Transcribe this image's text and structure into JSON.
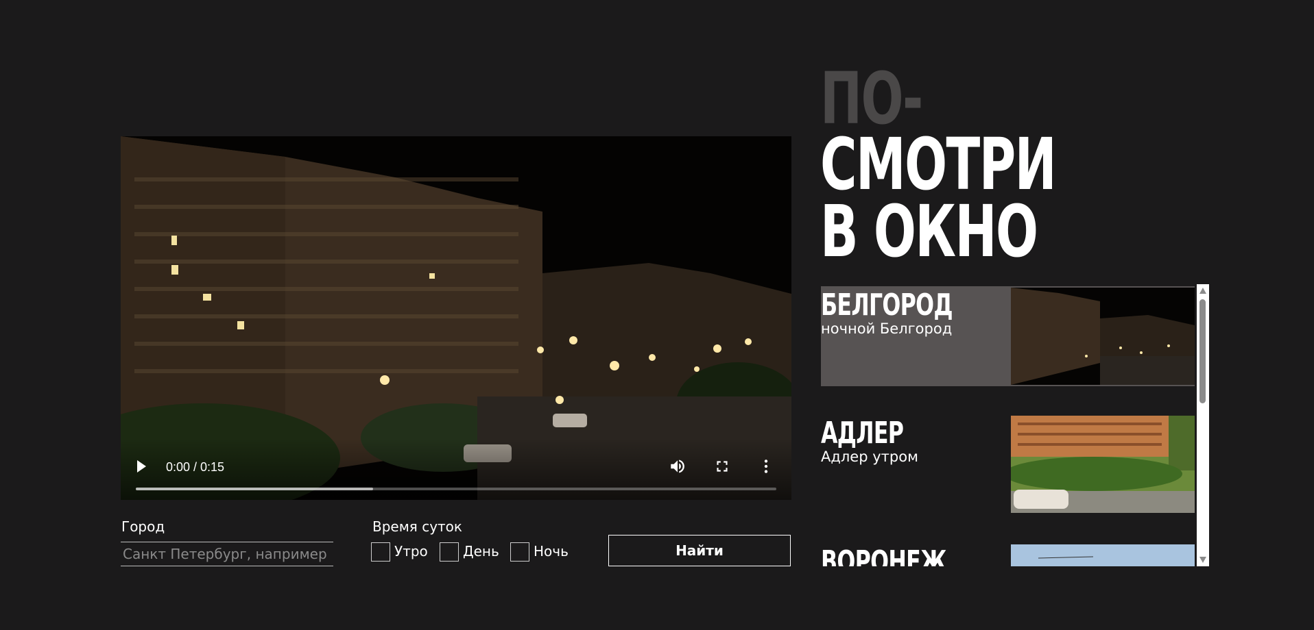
{
  "header": {
    "title_line1": "ПО-",
    "title_line2": "СМОТРИ",
    "title_line3": "В ОКНО"
  },
  "player": {
    "time": "0:00 / 0:15",
    "progress_fraction": 0.37
  },
  "search": {
    "city_label": "Город",
    "city_placeholder": "Санкт Петербург, например",
    "time_label": "Время суток",
    "options": [
      "Утро",
      "День",
      "Ночь"
    ],
    "find_label": "Найти"
  },
  "cities": [
    {
      "name": "БЕЛГОРОД",
      "description": "ночной Белгород",
      "active": true
    },
    {
      "name": "АДЛЕР",
      "description": "Адлер утром",
      "active": false
    },
    {
      "name": "ВОРОНЕЖ",
      "description": "",
      "active": false
    }
  ],
  "colors": {
    "background": "#1b1a1b",
    "active_item": "#575353",
    "title_muted": "#4a4848"
  },
  "icons": {
    "play": "play-icon",
    "volume": "volume-icon",
    "fullscreen": "fullscreen-icon",
    "more": "more-vertical-icon"
  }
}
